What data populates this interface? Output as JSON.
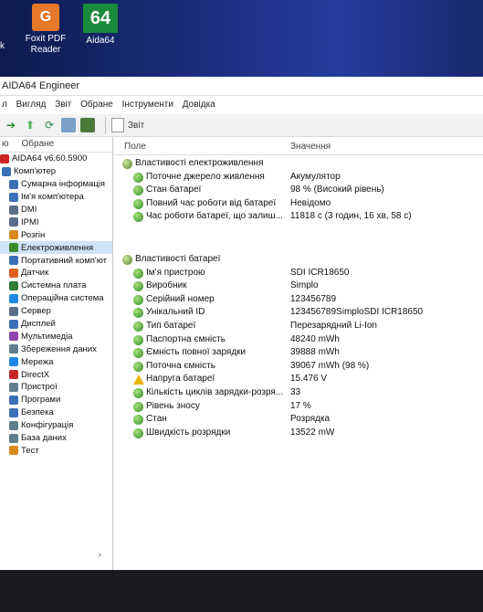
{
  "desktop": {
    "left_fragment": "k",
    "icons": [
      {
        "name": "Foxit PDF Reader",
        "glyph": "G"
      },
      {
        "name": "Aida64",
        "glyph": "64"
      }
    ]
  },
  "window": {
    "title": "AIDA64 Engineer",
    "menu": [
      "л",
      "Вигляд",
      "Звіт",
      "Обране",
      "Інструменти",
      "Довідка"
    ],
    "toolbar": {
      "report_label": "Звіт"
    }
  },
  "tree": {
    "tabs": [
      "ю",
      "Обране"
    ],
    "items": [
      {
        "label": "AIDA64 v6.60.5900",
        "color": "#cc2222"
      },
      {
        "label": "Комп'ютер",
        "color": "#3b6fb6"
      },
      {
        "label": "Сумарна інформація",
        "color": "#3b6fb6"
      },
      {
        "label": "Ім'я комп'ютера",
        "color": "#3b6fb6"
      },
      {
        "label": "DMI",
        "color": "#5a6e8a"
      },
      {
        "label": "IPMI",
        "color": "#5a6e8a"
      },
      {
        "label": "Розгін",
        "color": "#d88a1a"
      },
      {
        "label": "Електроживлення",
        "color": "#3a8a2a",
        "selected": true
      },
      {
        "label": "Портативний комп'ют",
        "color": "#3b6fb6"
      },
      {
        "label": "Датчик",
        "color": "#e06020"
      },
      {
        "label": "Системна плата",
        "color": "#2e7d32"
      },
      {
        "label": "Операційна система",
        "color": "#1e88e5"
      },
      {
        "label": "Сервер",
        "color": "#5a6e8a"
      },
      {
        "label": "Дисплей",
        "color": "#3b6fb6"
      },
      {
        "label": "Мультимедіа",
        "color": "#8e44ad"
      },
      {
        "label": "Збереження даних",
        "color": "#607d8b"
      },
      {
        "label": "Мережа",
        "color": "#1e88e5"
      },
      {
        "label": "DirectX",
        "color": "#c62828"
      },
      {
        "label": "Пристрої",
        "color": "#607d8b"
      },
      {
        "label": "Програми",
        "color": "#3b6fb6"
      },
      {
        "label": "Безпека",
        "color": "#3b6fb6"
      },
      {
        "label": "Конфігурація",
        "color": "#607d8b"
      },
      {
        "label": "База даних",
        "color": "#607d8b"
      },
      {
        "label": "Тест",
        "color": "#d88a1a"
      }
    ],
    "scroll_glyph": "›"
  },
  "list": {
    "col_field": "Поле",
    "col_value": "Значення",
    "rows": [
      {
        "field": "Властивості електроживлення",
        "value": "",
        "group": true
      },
      {
        "field": "Поточне джерело живлення",
        "value": "Акумулятор"
      },
      {
        "field": "Стан батареї",
        "value": "98 % (Високий рівень)"
      },
      {
        "field": "Повний час роботи від батареї",
        "value": "Невідомо"
      },
      {
        "field": "Час роботи батареї, що залиш...",
        "value": "11818 с (3 годин, 16 хв, 58 с)"
      },
      {
        "field": "",
        "value": "",
        "spacer": true
      },
      {
        "field": "Властивості батареї",
        "value": "",
        "group": true
      },
      {
        "field": "Ім'я пристрою",
        "value": "SDI ICR18650"
      },
      {
        "field": "Виробник",
        "value": "Simplo"
      },
      {
        "field": "Серійний номер",
        "value": "123456789"
      },
      {
        "field": "Унікальний ID",
        "value": "123456789SimploSDI ICR18650"
      },
      {
        "field": "Тип батареї",
        "value": "Перезарядний Li-Ion"
      },
      {
        "field": "Паспортна ємність",
        "value": "48240 mWh"
      },
      {
        "field": "Ємність повної зарядки",
        "value": "39888 mWh"
      },
      {
        "field": "Поточна ємність",
        "value": "39067 mWh  (98 %)"
      },
      {
        "field": "Напруга батареї",
        "value": "15.476 V",
        "warn": true
      },
      {
        "field": "Кількість циклів зарядки-розря...",
        "value": "33"
      },
      {
        "field": "Рівень зносу",
        "value": "17 %"
      },
      {
        "field": "Стан",
        "value": "Розрядка"
      },
      {
        "field": "Швидкість розрядки",
        "value": "13522 mW"
      }
    ]
  }
}
